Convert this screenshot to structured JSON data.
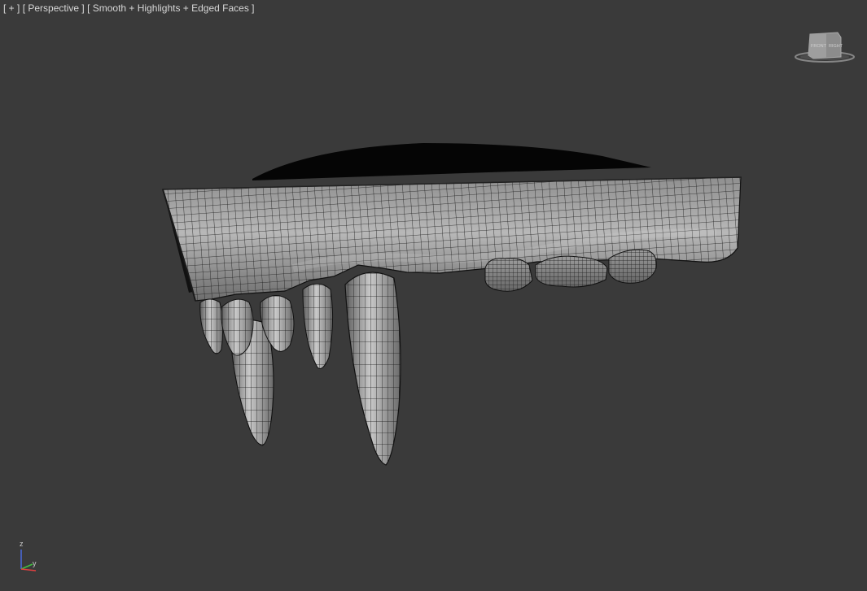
{
  "viewport": {
    "label_plus": "[ + ]",
    "label_view": "[ Perspective ]",
    "label_shading": "[ Smooth + Highlights + Edged Faces ]",
    "background_color": "#3a3a3a"
  },
  "viewcube": {
    "face_text": "FRONT RIGHT",
    "icon": "viewcube-icon"
  },
  "axis_tripod": {
    "z_label": "z",
    "y_label": "y",
    "icon": "axis-tripod-icon",
    "colors": {
      "x": "#e04040",
      "y": "#40c040",
      "z": "#4a6adf"
    }
  },
  "model": {
    "description_icon": "teeth-mesh-model",
    "wire_color": "#111111",
    "surface_color": "#a9a9a9"
  }
}
